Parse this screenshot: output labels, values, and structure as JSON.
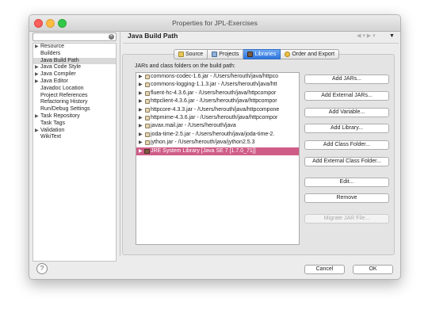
{
  "window": {
    "title": "Properties for JPL-Exercises"
  },
  "sidebar": {
    "filter_value": "",
    "items": [
      {
        "label": "Resource",
        "arrow": "▶"
      },
      {
        "label": "Builders",
        "arrow": ""
      },
      {
        "label": "Java Build Path",
        "arrow": ""
      },
      {
        "label": "Java Code Style",
        "arrow": "▶"
      },
      {
        "label": "Java Compiler",
        "arrow": "▶"
      },
      {
        "label": "Java Editor",
        "arrow": "▶"
      },
      {
        "label": "Javadoc Location",
        "arrow": ""
      },
      {
        "label": "Project References",
        "arrow": ""
      },
      {
        "label": "Refactoring History",
        "arrow": ""
      },
      {
        "label": "Run/Debug Settings",
        "arrow": ""
      },
      {
        "label": "Task Repository",
        "arrow": "▶"
      },
      {
        "label": "Task Tags",
        "arrow": ""
      },
      {
        "label": "Validation",
        "arrow": "▶"
      },
      {
        "label": "WikiText",
        "arrow": ""
      }
    ],
    "selected_index": 2
  },
  "page": {
    "title": "Java Build Path",
    "tabs": [
      {
        "label": "Source",
        "icon": "source-folder-icon",
        "active": false
      },
      {
        "label": "Projects",
        "icon": "projects-icon",
        "active": false
      },
      {
        "label": "Libraries",
        "icon": "libraries-icon",
        "active": true
      },
      {
        "label": "Order and Export",
        "icon": "order-export-icon",
        "active": false
      }
    ],
    "list_label": "JARs and class folders on the build path:",
    "entries": [
      {
        "text": "commons-codec-1.6.jar - /Users/herouth/java/httpco",
        "type": "jar"
      },
      {
        "text": "commons-logging-1.1.3.jar - /Users/herouth/java/htt",
        "type": "jar"
      },
      {
        "text": "fluent-hc-4.3.6.jar - /Users/herouth/java/httpcompor",
        "type": "jar"
      },
      {
        "text": "httpclient-4.3.6.jar - /Users/herouth/java/httpcompor",
        "type": "jar"
      },
      {
        "text": "httpcore-4.3.3.jar - /Users/herouth/java/httpcompone",
        "type": "jar"
      },
      {
        "text": "httpmime-4.3.6.jar - /Users/herouth/java/httpcompor",
        "type": "jar"
      },
      {
        "text": "javax.mail.jar - /Users/herouth/java",
        "type": "jar"
      },
      {
        "text": "joda-time-2.5.jar - /Users/herouth/java/joda-time-2.",
        "type": "jar"
      },
      {
        "text": "jython.jar - /Users/herouth/java/jython2.5.3",
        "type": "jar"
      },
      {
        "text": "JRE System Library [Java SE 7 [1.7.0_71]]",
        "type": "library",
        "selected": true
      }
    ],
    "buttons": {
      "add_jars": "Add JARs...",
      "add_external_jars": "Add External JARs...",
      "add_variable": "Add Variable...",
      "add_library": "Add Library...",
      "add_class_folder": "Add Class Folder...",
      "add_external_class_folder": "Add External Class Folder...",
      "edit": "Edit...",
      "remove": "Remove",
      "migrate_jar": "Migrate JAR File..."
    }
  },
  "footer": {
    "help": "?",
    "cancel": "Cancel",
    "ok": "OK"
  },
  "colors": {
    "accent": "#2f76dd",
    "selection": "#cf5d88",
    "window_bg": "#ececec"
  }
}
